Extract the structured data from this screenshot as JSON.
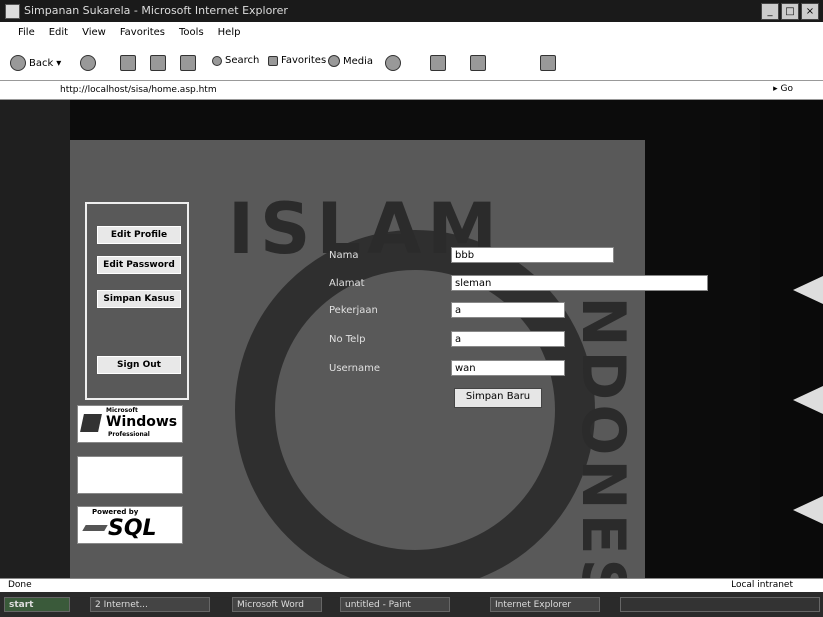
{
  "window": {
    "title": "Simpanan Sukarela - Microsoft Internet Explorer"
  },
  "menu": [
    "File",
    "Edit",
    "View",
    "Favorites",
    "Tools",
    "Help"
  ],
  "toolbar": {
    "back": "Back",
    "search": "Search",
    "favorites": "Favorites",
    "media": "Media"
  },
  "address": {
    "url": "http://localhost/sisa/home.asp.htm",
    "go": "Go"
  },
  "sidebar": {
    "items": [
      {
        "label": "Edit Profile"
      },
      {
        "label": "Edit Password"
      },
      {
        "label": "Simpan Kasus"
      },
      {
        "label": "Sign Out"
      }
    ]
  },
  "badges": {
    "windows": {
      "small": "Microsoft",
      "big": "Windows",
      "sub": "Professional"
    },
    "sql": {
      "small": "Powered by",
      "big": "SQL"
    }
  },
  "watermark": {
    "main": "ISLAM",
    "side": "INDONES"
  },
  "form": {
    "fields": [
      {
        "label": "Nama",
        "value": "bbb"
      },
      {
        "label": "Alamat",
        "value": "sleman"
      },
      {
        "label": "Pekerjaan",
        "value": "a"
      },
      {
        "label": "No Telp",
        "value": "a"
      },
      {
        "label": "Username",
        "value": "wan"
      }
    ],
    "submit_label": "Simpan Baru"
  },
  "statusbar": {
    "left": "Done",
    "right": "Local intranet"
  },
  "taskbar": {
    "start": "start",
    "items": [
      "2 Internet...",
      "Microsoft Word",
      "untitled - Paint",
      "Internet Explorer"
    ]
  }
}
